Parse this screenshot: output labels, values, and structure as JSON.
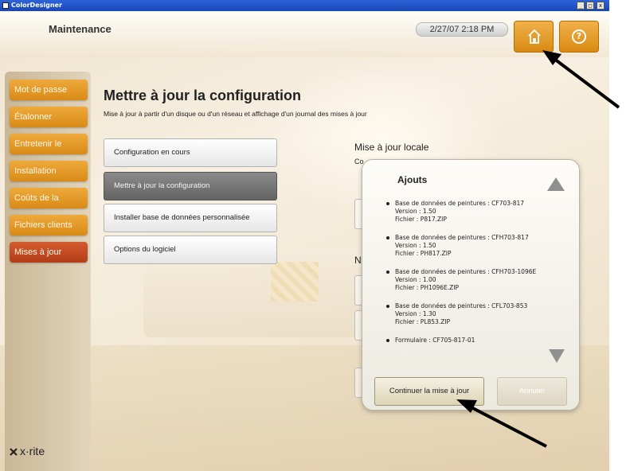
{
  "window": {
    "title": "ColorDesigner",
    "controls": [
      "_",
      "□",
      "x"
    ]
  },
  "header": {
    "title": "Maintenance",
    "datetime": "2/27/07 2:18 PM"
  },
  "sidebar": {
    "items": [
      {
        "label": "Mot de passe",
        "active": false
      },
      {
        "label": "Étalonner",
        "active": false
      },
      {
        "label": "Entretenir le",
        "active": false
      },
      {
        "label": "Installation",
        "active": false
      },
      {
        "label": "Coûts de la",
        "active": false
      },
      {
        "label": "Fichiers clients",
        "active": false
      },
      {
        "label": "Mises à jour",
        "active": true
      }
    ],
    "logo": "x·rite"
  },
  "main": {
    "title": "Mettre à jour la configuration",
    "description": "Mise à jour à partir d'un disque ou d'un réseau et affichage d'un journal des mises à jour",
    "buttons": [
      {
        "label": "Configuration en cours",
        "selected": false
      },
      {
        "label": "Mettre à jour la configuration",
        "selected": true
      },
      {
        "label": "Installer base de données personnalisée",
        "selected": false
      },
      {
        "label": "Options du logiciel",
        "selected": false
      }
    ],
    "right_section_label": "Mise à jour locale",
    "partial_label_1": "Co",
    "partial_label_2": "N"
  },
  "popup": {
    "title": "Ajouts",
    "items": [
      {
        "line1": "Base de données de peintures : CF703-817",
        "line2": "Version : 1.50",
        "line3": "Fichier : P817.ZIP"
      },
      {
        "line1": "Base de données de peintures : CFH703-817",
        "line2": "Version : 1.50",
        "line3": "Fichier : PH817.ZIP"
      },
      {
        "line1": "Base de données de peintures : CFH703-1096E",
        "line2": "Version : 1.00",
        "line3": "Fichier : PH1096E.ZIP"
      },
      {
        "line1": "Base de données de peintures : CFL703-853",
        "line2": "Version : 1.30",
        "line3": "Fichier : PL853.ZIP"
      },
      {
        "line1": "Formulaire : CF705-817-01",
        "line2": "",
        "line3": ""
      }
    ],
    "continue_label": "Continuer la mise à jour",
    "cancel_label": "Annuler"
  },
  "colors": {
    "accent_orange": "#e0921f",
    "active_red": "#c14a22",
    "selected_gray": "#767676"
  }
}
